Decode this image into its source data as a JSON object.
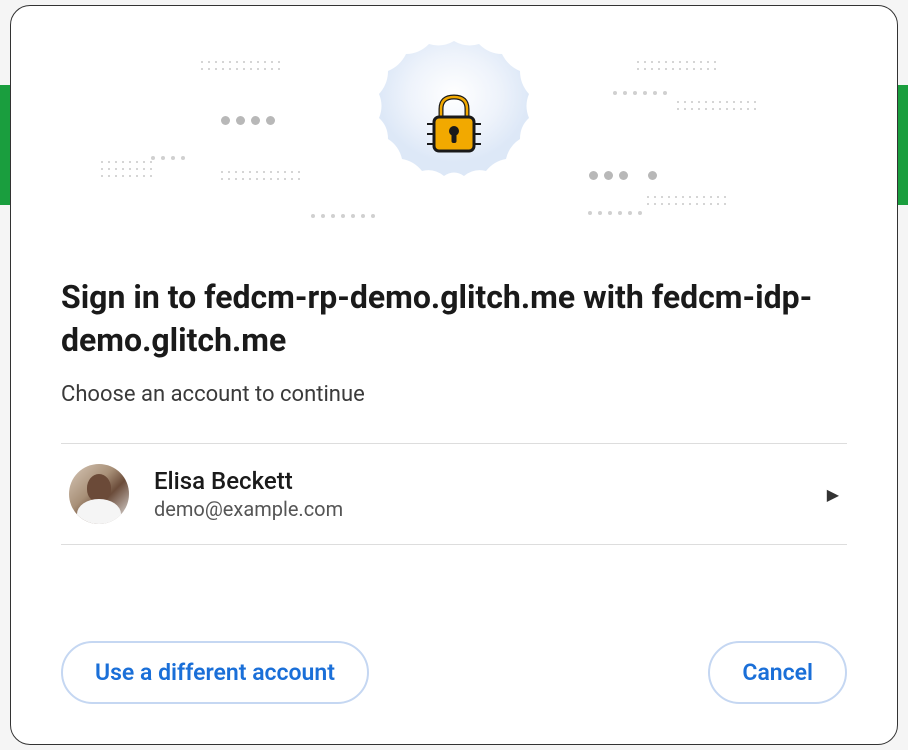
{
  "dialog": {
    "title": "Sign in to fedcm-rp-demo.glitch.me with fedcm-idp-demo.glitch.me",
    "subtitle": "Choose an account to continue"
  },
  "account": {
    "name": "Elisa Beckett",
    "email": "demo@example.com"
  },
  "buttons": {
    "different_account": "Use a different account",
    "cancel": "Cancel"
  }
}
